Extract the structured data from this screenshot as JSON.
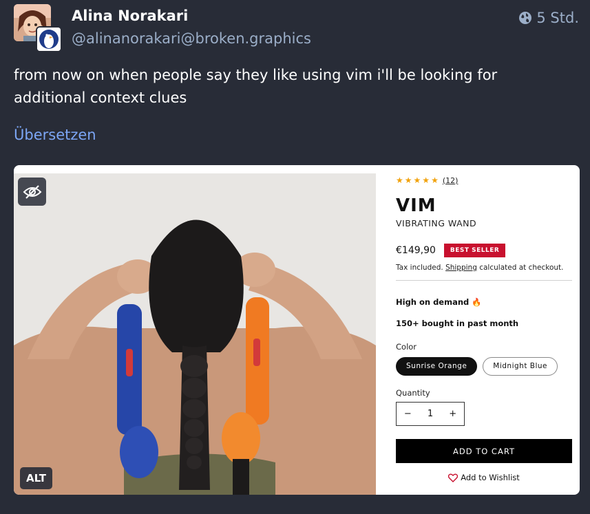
{
  "status": {
    "author": {
      "display_name": "Alina Norakari",
      "acct": "@alinanorakari@broken.graphics"
    },
    "time": "5 Std.",
    "visibility_icon": "globe-icon",
    "content": "from now on when people say they like using vim i'll be looking for additional context clues",
    "translate_label": "Übersetzen",
    "media": {
      "hide_icon": "eye-slash-icon",
      "alt_label": "ALT",
      "product": {
        "rating_stars": 5,
        "review_count": "(12)",
        "title": "VIM",
        "subtitle": "VIBRATING WAND",
        "price": "€149,90",
        "badge": "BEST SELLER",
        "tax_prefix": "Tax included.",
        "tax_link": "Shipping",
        "tax_suffix": "calculated at checkout.",
        "demand": "High on demand 🔥",
        "bought": "150+ bought in past month",
        "color_label": "Color",
        "color_options": [
          "Sunrise Orange",
          "Midnight Blue"
        ],
        "selected_color": "Sunrise Orange",
        "quantity_label": "Quantity",
        "qty_minus": "−",
        "qty_value": "1",
        "qty_plus": "+",
        "add_to_cart": "ADD TO CART",
        "wishlist": "Add to Wishlist"
      }
    }
  },
  "colors": {
    "background": "#282c37",
    "accent_link": "#7ca6f5",
    "muted": "#9baec8",
    "best_seller": "#c8102e",
    "star": "#f1a20c"
  }
}
